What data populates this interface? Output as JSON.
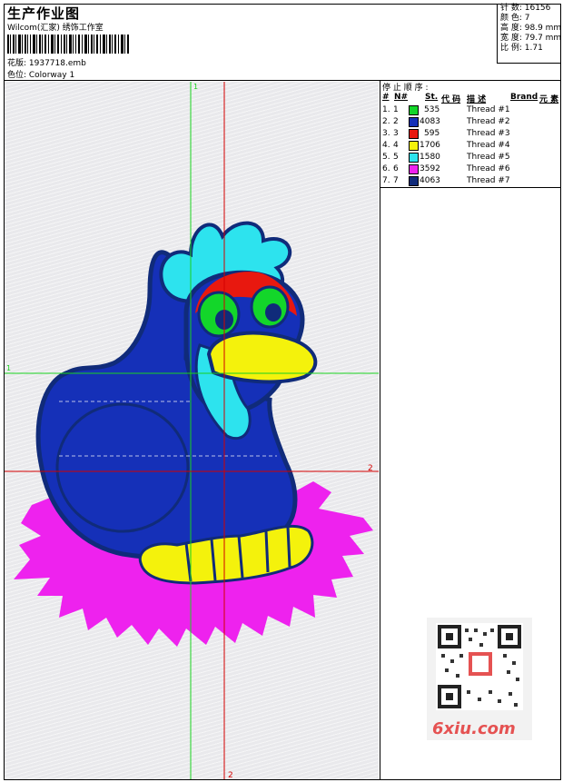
{
  "header": {
    "title": "生产作业图",
    "studio": "Wilcom(汇家) 绣饰工作室",
    "design_label": "花版: 1937718.emb",
    "colorway_label": "色位: Colorway 1"
  },
  "stats": {
    "stitches": "针 数: 16156",
    "colors": "颜 色: 7",
    "height": "高 度: 98.9 mm",
    "width": "宽 度: 79.7 mm",
    "ratio": "比 例: 1.71"
  },
  "threads": {
    "title": "停 止 顺 序 :",
    "headers": [
      "#",
      "N#",
      "St.",
      "代 码",
      "描 述",
      "Brand",
      "元 素"
    ],
    "rows": [
      {
        "idx": "1.",
        "n": "1",
        "color": "#13d62a",
        "code": "535",
        "desc": "Thread #1"
      },
      {
        "idx": "2.",
        "n": "2",
        "color": "#1530b8",
        "code": "4083",
        "desc": "Thread #2"
      },
      {
        "idx": "3.",
        "n": "3",
        "color": "#e8180f",
        "code": "595",
        "desc": "Thread #3"
      },
      {
        "idx": "4.",
        "n": "4",
        "color": "#f4f20c",
        "code": "1706",
        "desc": "Thread #4"
      },
      {
        "idx": "5.",
        "n": "5",
        "color": "#2de3ee",
        "code": "1580",
        "desc": "Thread #5"
      },
      {
        "idx": "6.",
        "n": "6",
        "color": "#ee22ee",
        "code": "3592",
        "desc": "Thread #6"
      },
      {
        "idx": "7.",
        "n": "7",
        "color": "#102b7a",
        "code": "4063",
        "desc": "Thread #7"
      }
    ]
  },
  "canvas": {
    "marker_1": "1",
    "marker_2": "2",
    "colors": {
      "crosshair_green": "#19d21e",
      "crosshair_red": "#d40000",
      "body_blue": "#1530b8",
      "outline": "#102b7a",
      "cyan": "#2de3ee",
      "yellow": "#f4f20c",
      "red": "#e8180f",
      "green": "#13d62a",
      "magenta": "#ee22ee"
    }
  },
  "watermark": {
    "site": "6xiu.com"
  }
}
